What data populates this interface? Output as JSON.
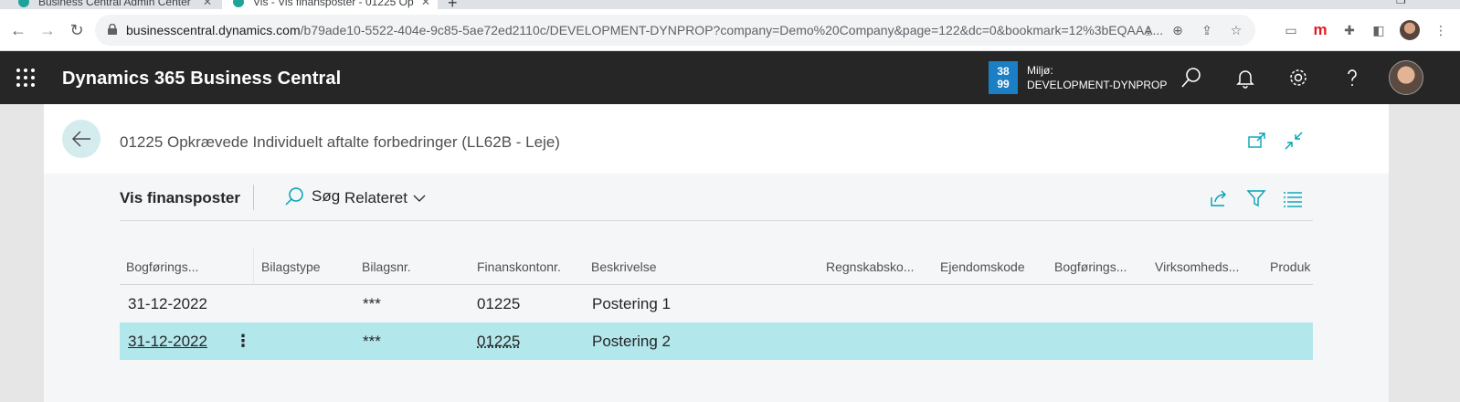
{
  "browser": {
    "tabs": [
      {
        "label": "Business Central Admin Center"
      },
      {
        "label": "Vis - Vis finansposter - 01225 Op"
      }
    ],
    "new_tab": "+",
    "url_host": "businesscentral.dynamics.com",
    "url_path": "/b79ade10-5522-404e-9c85-5ae72ed2110c/DEVELOPMENT-DYNPROP?company=Demo%20Company&page=122&dc=0&bookmark=12%3bEQAAA..."
  },
  "app": {
    "name": "Dynamics 365 Business Central",
    "env_badge_top": "38",
    "env_badge_bottom": "99",
    "env_label": "Miljø:",
    "env_name": "DEVELOPMENT-DYNPROP"
  },
  "page": {
    "title": "01225 Opkrævede Individuelt aftalte forbedringer (LL62B - Leje)"
  },
  "actions": {
    "title": "Vis finansposter",
    "search": "Søg",
    "related": "Relateret"
  },
  "grid": {
    "columns": [
      "Bogførings...",
      "Bilagstype",
      "Bilagsnr.",
      "Finanskontonr.",
      "Beskrivelse",
      "Regnskabsko...",
      "Ejendomskode",
      "Bogførings...",
      "Virksomheds...",
      "Produk"
    ],
    "rows": [
      {
        "date": "31-12-2022",
        "doc_type": "",
        "doc_no": "***",
        "account": "01225",
        "description": "Postering 1"
      },
      {
        "date": "31-12-2022",
        "doc_type": "",
        "doc_no": "***",
        "account": "01225",
        "description": "Postering 2"
      }
    ],
    "selected_row": 2,
    "row_menu": "⋮"
  },
  "colors": {
    "appbar": "#262626",
    "accent": "#00a4b4",
    "selected_row": "#b2e7ec",
    "env_badge": "#1a7fc4"
  }
}
